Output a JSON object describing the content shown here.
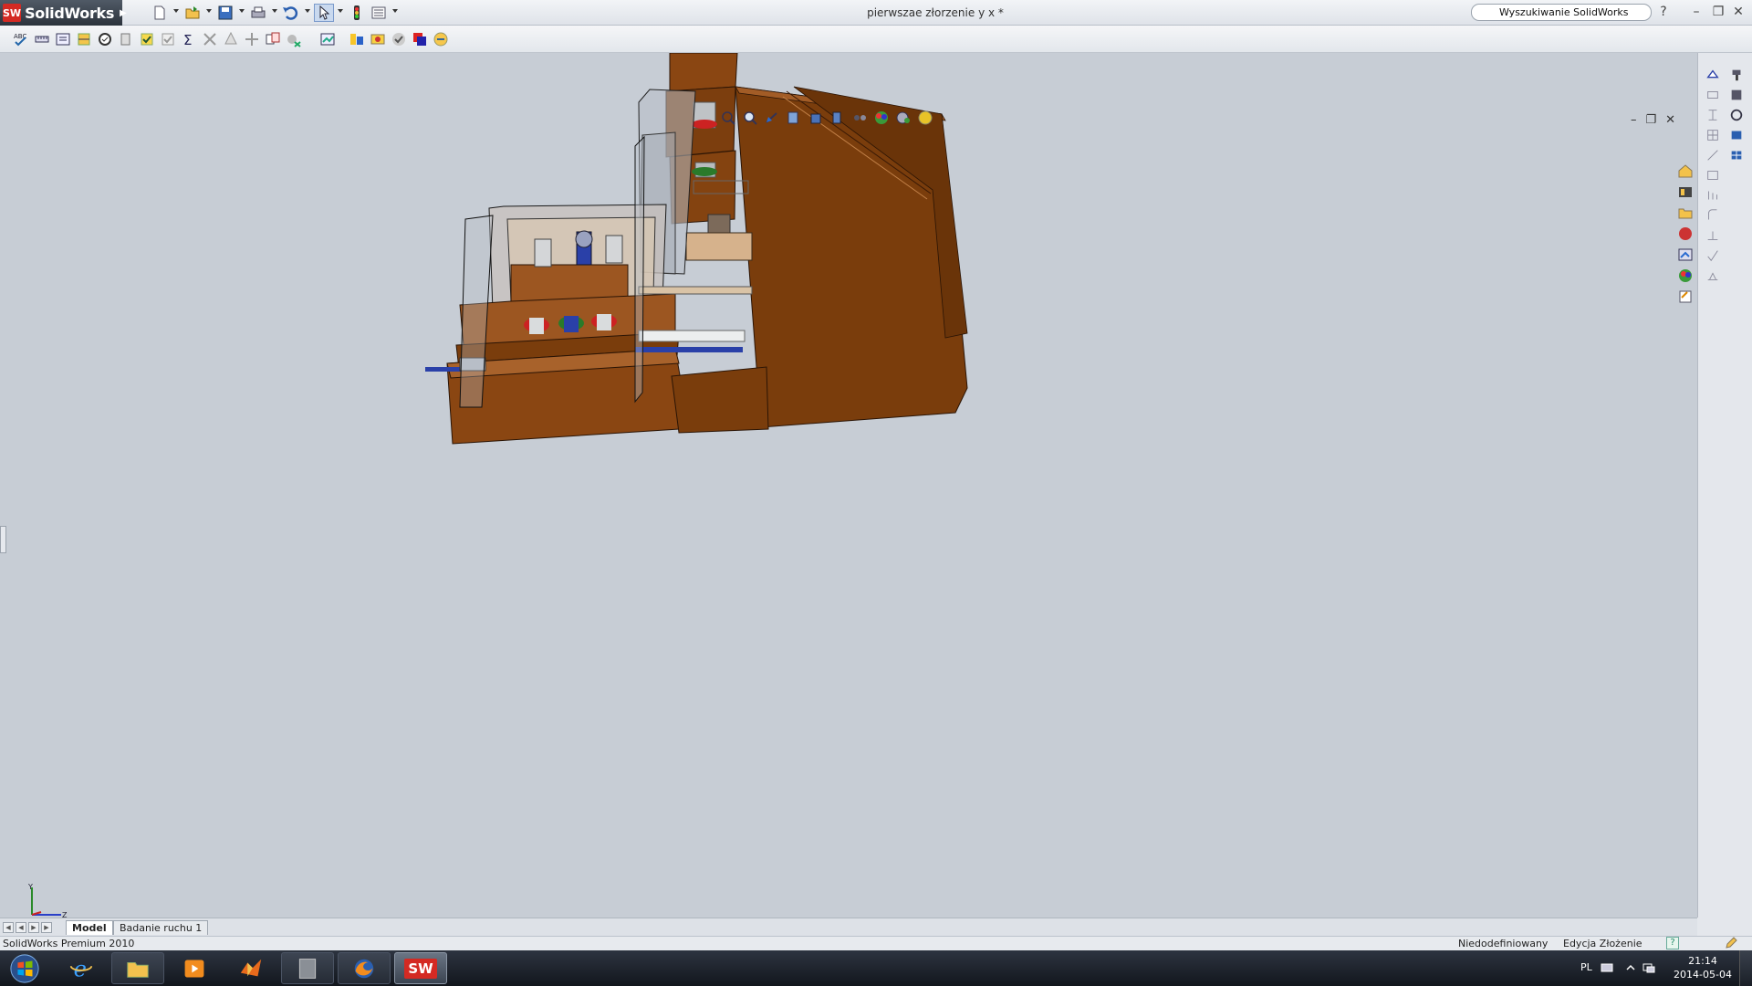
{
  "app": {
    "brand_badge": "SW",
    "brand_name": "SolidWorks",
    "document_title": "pierwszae złorzenie y x *",
    "search_placeholder": "Wyszukiwanie SolidWorks",
    "help_label": "?"
  },
  "title_controls": {
    "minimize": "–",
    "restore": "❐",
    "close": "✕"
  },
  "quick_access": [
    "new-document",
    "open",
    "save",
    "print",
    "undo",
    "select",
    "rebuild",
    "options"
  ],
  "command_toolbar": [
    "spelling",
    "measure",
    "mass-properties",
    "section-properties",
    "check",
    "geometry-analysis",
    "import-diagnostics",
    "interference",
    "sum",
    "clearance",
    "hole-alignment",
    "compare",
    "trace",
    "deviation",
    "assembly-visualization",
    "performance",
    "evaluate",
    "appearance",
    "sensor"
  ],
  "headsup_toolbar": [
    "zoom-to-fit",
    "zoom-area",
    "previous-view",
    "section-view",
    "view-orientation",
    "display-style",
    "hide-show",
    "edit-appearance",
    "apply-scene",
    "view-settings"
  ],
  "viewport_controls": {
    "minimize": "–",
    "restore": "❐",
    "close": "✕"
  },
  "triad": {
    "y_label": "Y",
    "z_label": "Z"
  },
  "task_pane_tabs": [
    "solidworks-resources",
    "design-library",
    "file-explorer",
    "search",
    "view-palette",
    "appearances-scenes",
    "custom-properties"
  ],
  "tabs": {
    "model": "Model",
    "motion_study": "Badanie ruchu 1"
  },
  "status": {
    "product": "SolidWorks Premium 2010",
    "definition": "Niedodefiniowany",
    "mode": "Edycja Złożenie",
    "help": "?"
  },
  "taskbar": {
    "apps": [
      "internet-explorer",
      "file-explorer",
      "media-player",
      "matlab",
      "app-5",
      "firefox",
      "solidworks"
    ],
    "sw_label": "SW",
    "language": "PL",
    "time": "21:14",
    "date": "2014-05-04"
  },
  "colors": {
    "model_wood": "#7a3d0c",
    "model_wood_light": "#9c5621",
    "background": "#c7cdd5",
    "accent_red": "#d42a23"
  }
}
